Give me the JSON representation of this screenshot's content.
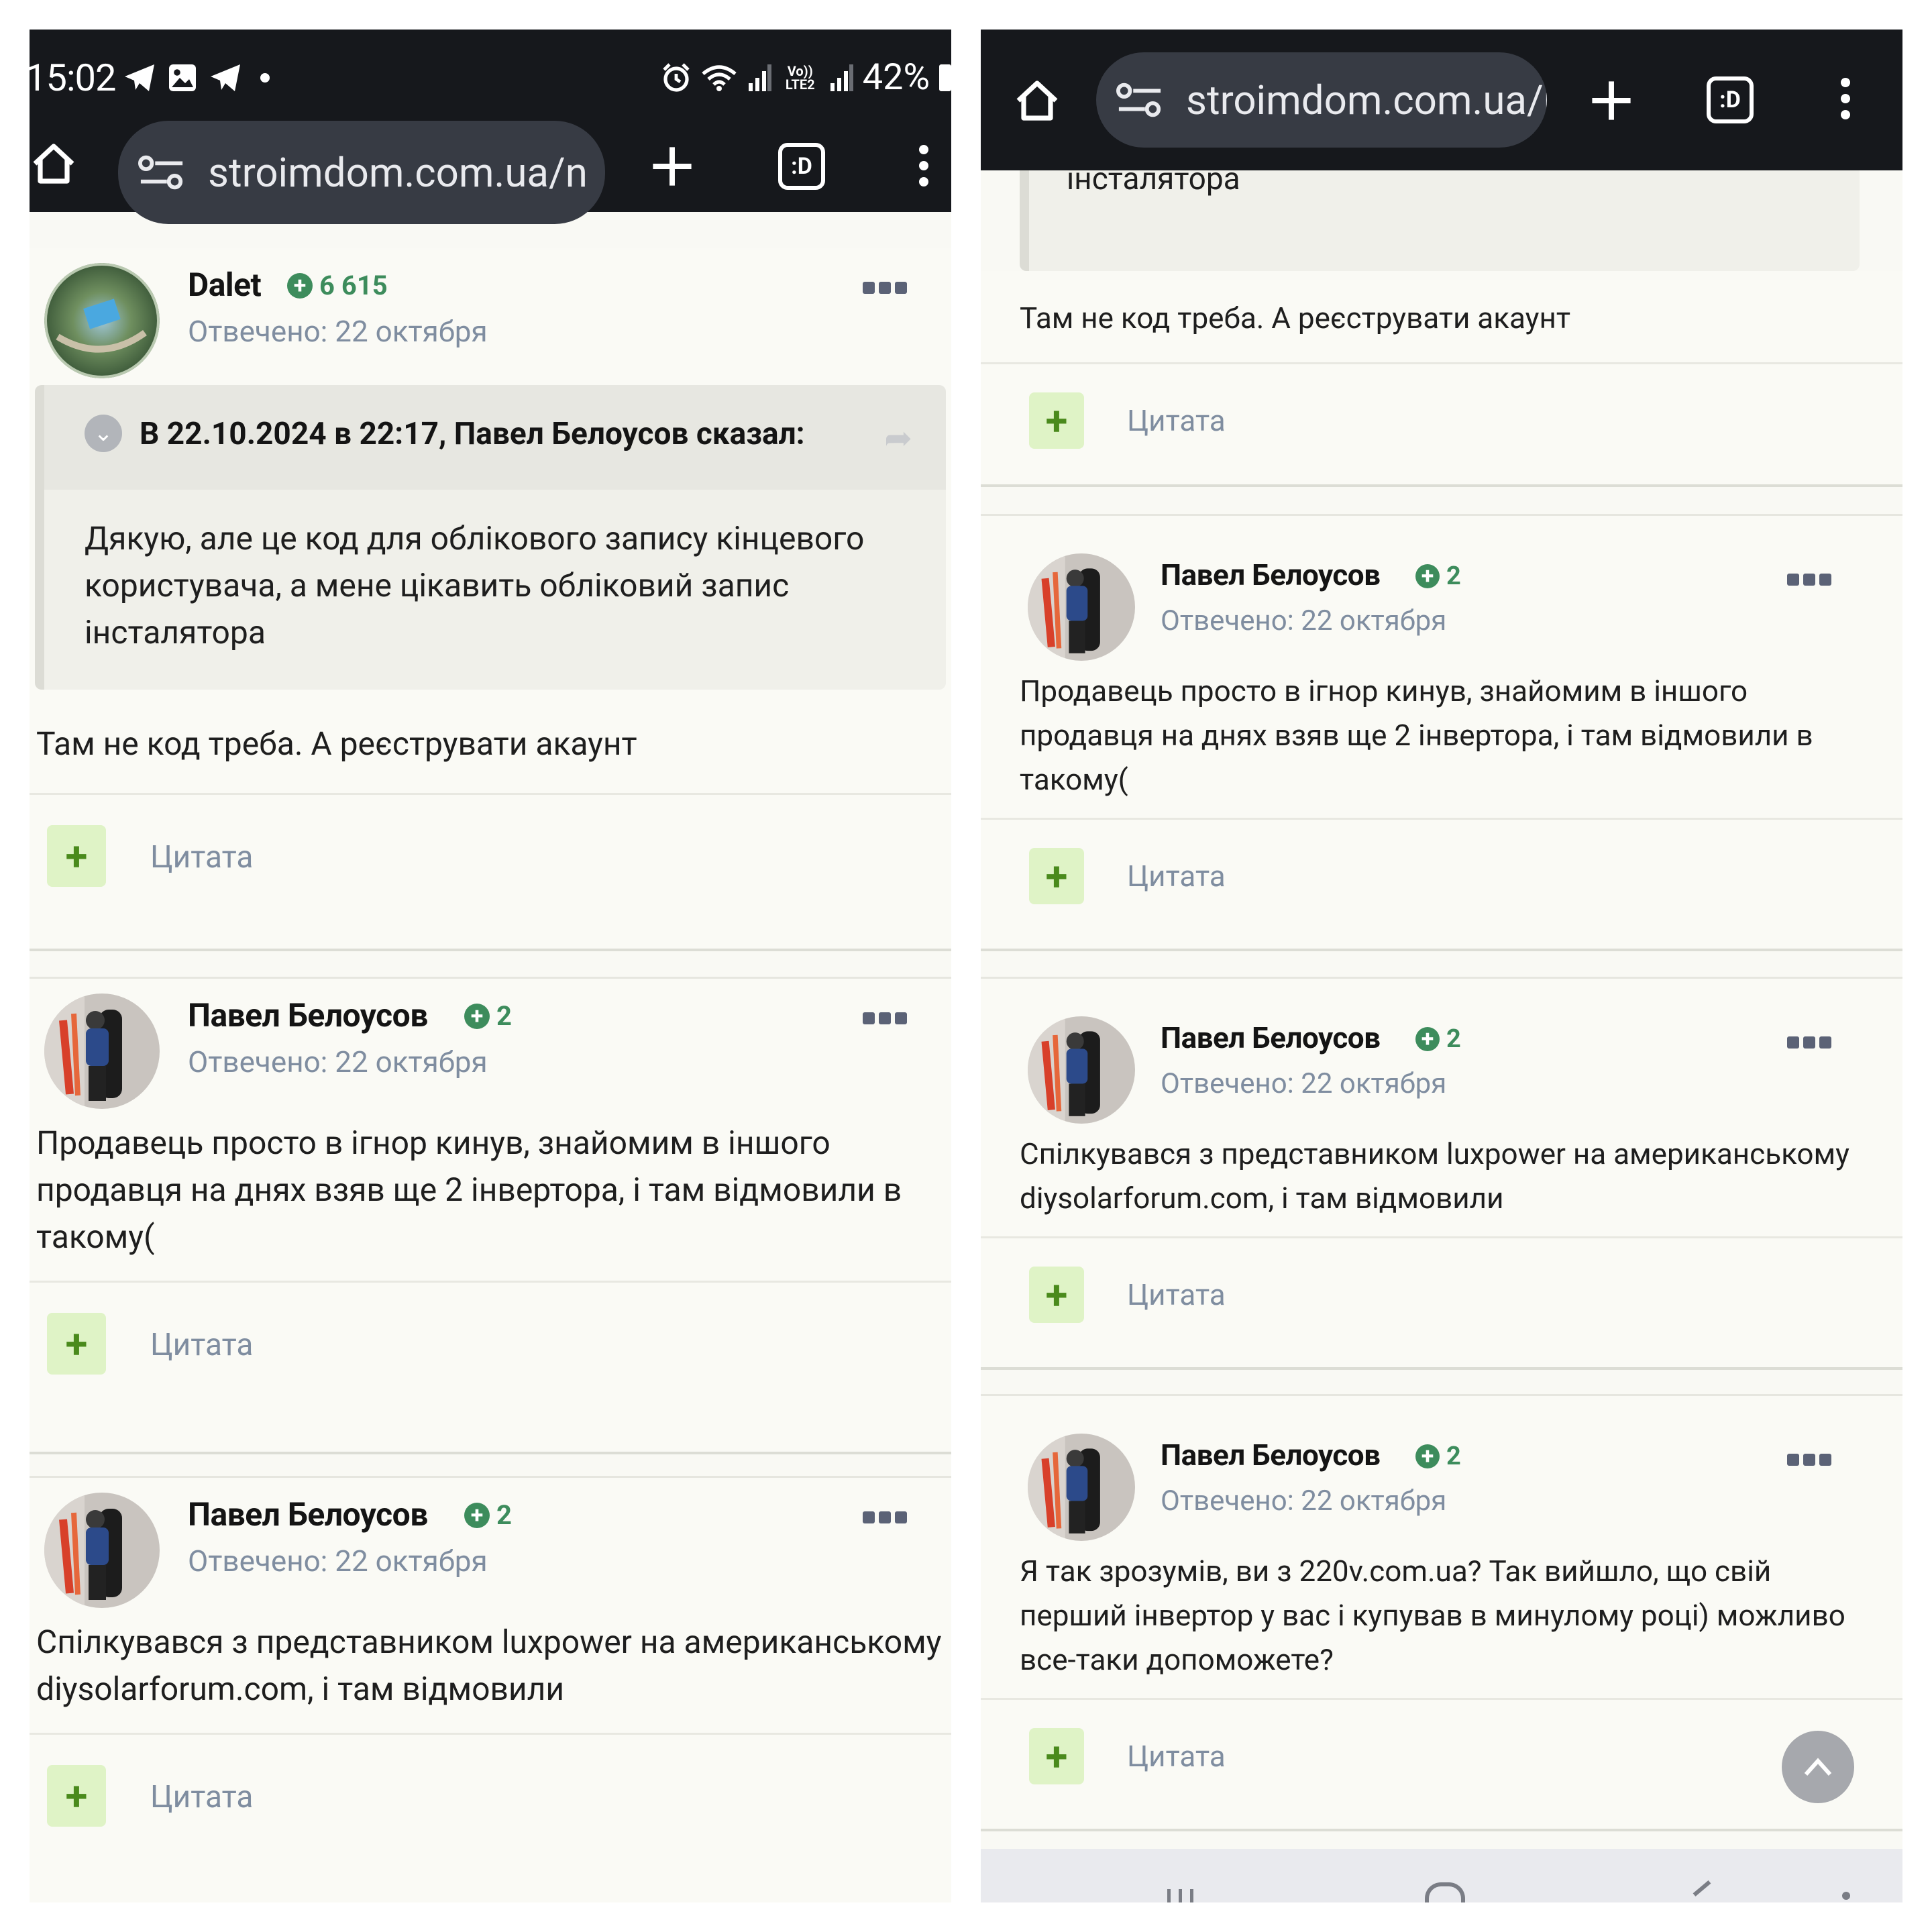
{
  "status_bar": {
    "time": "15:02",
    "battery": "42%",
    "icons_left": [
      "telegram-icon",
      "image-icon",
      "telegram-icon",
      "dot-icon"
    ],
    "icons_right": [
      "alarm-icon",
      "wifi-icon",
      "signal-icon",
      "volte-icon",
      "signal-icon",
      "battery-icon"
    ],
    "volte_label": "Vo)) LTE2"
  },
  "browser": {
    "url": "stroimdom.com.ua/n",
    "tab_count": ":D"
  },
  "left": {
    "posts": [
      {
        "author": "Dalet",
        "reputation": "6 615",
        "date": "Отвечено: 22 октября",
        "quote": {
          "title": "В 22.10.2024 в 22:17, Павел Белоусов сказал:",
          "text": "Дякую, але це код для облікового запису кінцевого користувача, а мене цікавить обліковий запис інсталятора"
        },
        "body": "Там не код треба. А реєструвати акаунт",
        "like_label": "+",
        "quote_label": "Цитата"
      },
      {
        "author": "Павел Белоусов",
        "reputation": "2",
        "date": "Отвечено: 22 октября",
        "body": "Продавець просто в ігнор кинув, знайомим в іншого продавця на днях взяв ще 2 інвертора, і там відмовили в такому(",
        "like_label": "+",
        "quote_label": "Цитата"
      },
      {
        "author": "Павел Белоусов",
        "reputation": "2",
        "date": "Отвечено: 22 октября",
        "body": "Спілкувався з представником luxpower на американському diysolarforum.com, і там відмовили",
        "like_label": "+",
        "quote_label": "Цитата"
      }
    ]
  },
  "right": {
    "quote_tail": "інсталятора",
    "first_body": "Там не код треба. А реєструвати акаунт",
    "first_quote_label": "Цитата",
    "posts": [
      {
        "author": "Павел Белоусов",
        "reputation": "2",
        "date": "Отвечено: 22 октября",
        "body": "Продавець просто в ігнор кинув, знайомим в іншого продавця на днях взяв ще 2 інвертора, і там відмовили в такому(",
        "like_label": "+",
        "quote_label": "Цитата"
      },
      {
        "author": "Павел Белоусов",
        "reputation": "2",
        "date": "Отвечено: 22 октября",
        "body": "Спілкувався з представником luxpower на американському diysolarforum.com, і там відмовили",
        "like_label": "+",
        "quote_label": "Цитата"
      },
      {
        "author": "Павел Белоусов",
        "reputation": "2",
        "date": "Отвечено: 22 октября",
        "body": "Я так зрозумів, ви з 220v.com.ua? Так вийшло, що свій перший інвертор у вас і купував в минулому році) можливо все-таки допоможете?",
        "like_label": "+",
        "quote_label": "Цитата"
      }
    ]
  },
  "colors": {
    "browser_bar": "#16181c",
    "url_pill": "#373b44",
    "page_bg": "#f9f9f4",
    "reputation_green": "#3d8c5c",
    "like_bg": "#dff3c6",
    "meta_gray": "#7f8da0"
  }
}
